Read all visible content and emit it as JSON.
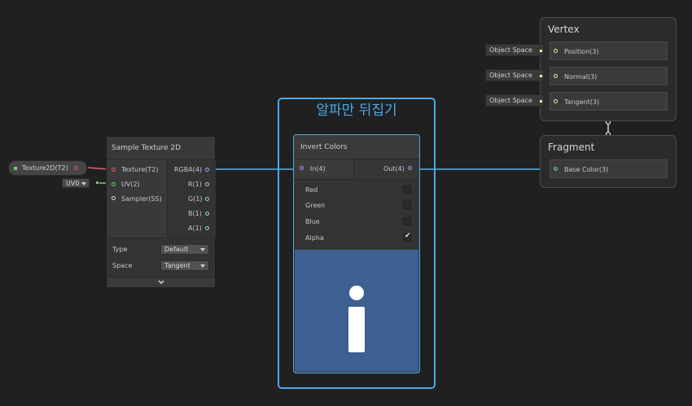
{
  "colors": {
    "background": "#202020",
    "selection": "#4aa9e8",
    "texture_wire": "#e06060",
    "uv_wire": "#6ed168",
    "vector4_wire": "#58b5f0",
    "vector3_wire": "#f2f28f",
    "sampler_port": "#dddddd"
  },
  "group": {
    "title": "알파만 뒤집기"
  },
  "texture_property": {
    "label": "Texture2D(T2)"
  },
  "uv_selector": {
    "value": "UV0"
  },
  "sample_texture": {
    "title": "Sample Texture 2D",
    "inputs": [
      "Texture(T2)",
      "UV(2)",
      "Sampler(SS)"
    ],
    "outputs": [
      "RGBA(4)",
      "R(1)",
      "G(1)",
      "B(1)",
      "A(1)"
    ],
    "type_label": "Type",
    "type_value": "Default",
    "space_label": "Space",
    "space_value": "Tangent",
    "expand_icon": "chevron-down-icon"
  },
  "invert_colors": {
    "title": "Invert Colors",
    "input": "In(4)",
    "output": "Out(4)",
    "channels": [
      {
        "label": "Red",
        "checked": false
      },
      {
        "label": "Green",
        "checked": false
      },
      {
        "label": "Blue",
        "checked": false
      },
      {
        "label": "Alpha",
        "checked": true
      }
    ],
    "preview_icon": "info-icon",
    "preview_color": "#3d5f91"
  },
  "vertex": {
    "title": "Vertex",
    "items": [
      {
        "space": "Object Space",
        "label": "Position(3)"
      },
      {
        "space": "Object Space",
        "label": "Normal(3)"
      },
      {
        "space": "Object Space",
        "label": "Tangent(3)"
      }
    ]
  },
  "fragment": {
    "title": "Fragment",
    "items": [
      {
        "label": "Base Color(3)"
      }
    ]
  }
}
